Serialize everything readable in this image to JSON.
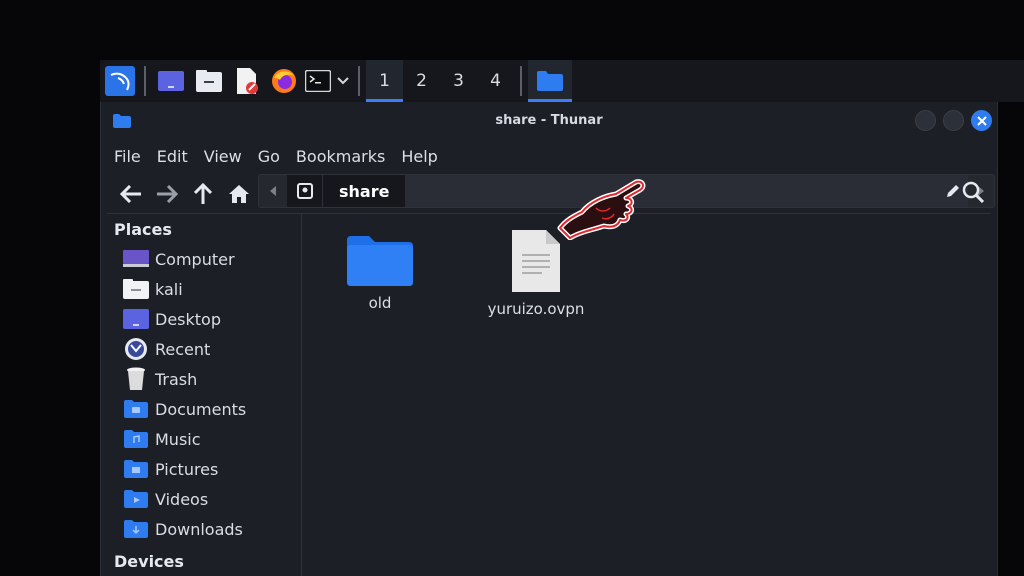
{
  "panel": {
    "workspaces": [
      "1",
      "2",
      "3",
      "4"
    ],
    "active_workspace": "1",
    "launchers": [
      "kali-menu-icon",
      "desktop-icon",
      "file-manager-icon",
      "text-editor-icon",
      "firefox-icon",
      "terminal-icon",
      "chevron-down-icon"
    ]
  },
  "window": {
    "title": "share - Thunar"
  },
  "menubar": {
    "items": [
      "File",
      "Edit",
      "View",
      "Go",
      "Bookmarks",
      "Help"
    ]
  },
  "pathbar": {
    "current": "share"
  },
  "sidebar": {
    "places_heading": "Places",
    "devices_heading": "Devices",
    "places": [
      {
        "label": "Computer",
        "icon": "computer-icon"
      },
      {
        "label": "kali",
        "icon": "home-folder-icon"
      },
      {
        "label": "Desktop",
        "icon": "desktop-icon"
      },
      {
        "label": "Recent",
        "icon": "recent-icon"
      },
      {
        "label": "Trash",
        "icon": "trash-icon"
      },
      {
        "label": "Documents",
        "icon": "documents-folder-icon"
      },
      {
        "label": "Music",
        "icon": "music-folder-icon"
      },
      {
        "label": "Pictures",
        "icon": "pictures-folder-icon"
      },
      {
        "label": "Videos",
        "icon": "videos-folder-icon"
      },
      {
        "label": "Downloads",
        "icon": "downloads-folder-icon"
      }
    ]
  },
  "files": [
    {
      "name": "old",
      "type": "folder"
    },
    {
      "name": "yuruizo.ovpn",
      "type": "document"
    }
  ],
  "colors": {
    "accent": "#3d7df5",
    "folder": "#2f7bf0",
    "pointer_outline": "#e0282e"
  }
}
